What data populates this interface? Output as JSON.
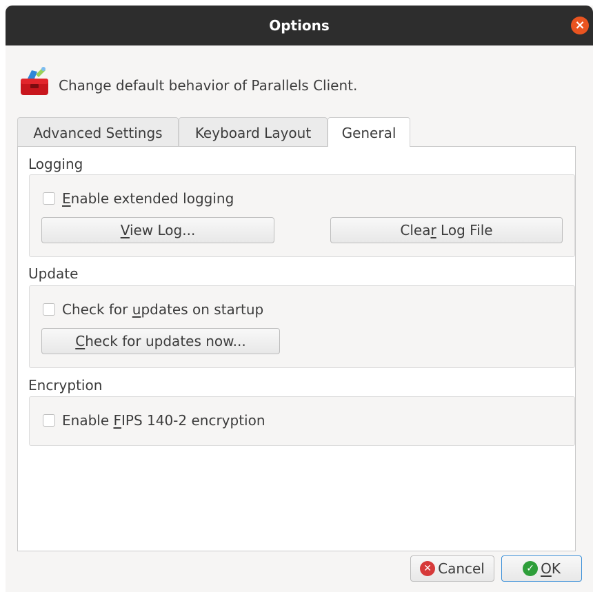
{
  "window": {
    "title": "Options"
  },
  "header": {
    "text": "Change default behavior of Parallels Client."
  },
  "tabs": [
    {
      "label": "Advanced Settings"
    },
    {
      "label": "Keyboard Layout"
    },
    {
      "label": "General"
    }
  ],
  "general": {
    "logging": {
      "title": "Logging",
      "enable_extended_logging": {
        "u": "E",
        "rest": "nable extended logging",
        "checked": false
      },
      "view_log_button": {
        "u": "V",
        "rest": "iew Log..."
      },
      "clear_log_button": {
        "pre": "Clea",
        "u": "r",
        "rest": " Log File"
      }
    },
    "update": {
      "title": "Update",
      "check_on_startup": {
        "pre": "Check for ",
        "u": "u",
        "rest": "pdates on startup",
        "checked": false
      },
      "check_now_button": {
        "u": "C",
        "rest": "heck for updates now..."
      }
    },
    "encryption": {
      "title": "Encryption",
      "enable_fips": {
        "pre": "Enable ",
        "u": "F",
        "rest": "IPS 140-2 encryption",
        "checked": false
      }
    }
  },
  "footer": {
    "cancel_label": "Cancel",
    "ok": {
      "u": "O",
      "rest": "K"
    }
  },
  "colors": {
    "accent": "#e95420",
    "ok_border": "#3a8fd8",
    "ok_icon": "#2e9e3a",
    "cancel_icon": "#d63a3a"
  }
}
